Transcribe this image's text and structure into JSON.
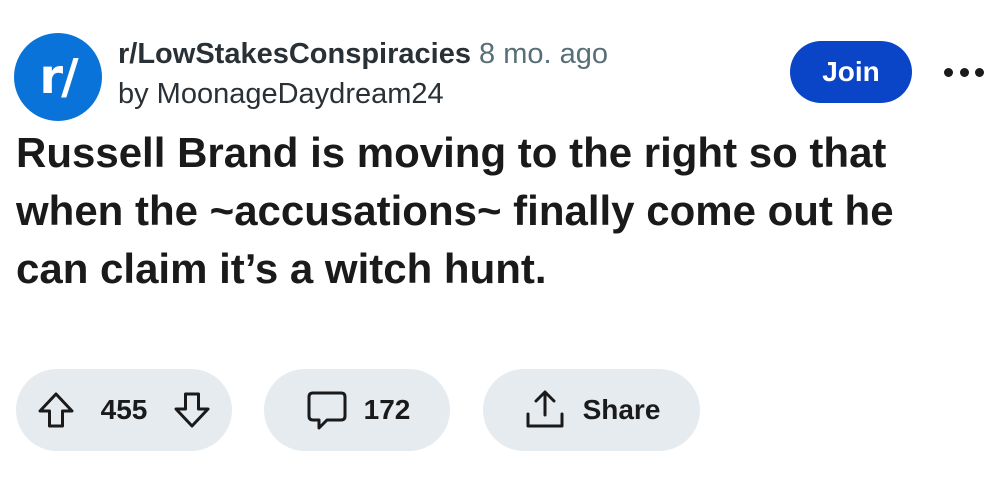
{
  "post": {
    "subreddit_avatar_text": "r/",
    "subreddit": "r/LowStakesConspiracies",
    "time_ago": "8 mo. ago",
    "author_line": "by MoonageDaydream24",
    "join_label": "Join",
    "title": "Russell Brand is moving to the right so that when the ~accusations~ finally come out he can claim it’s a witch hunt."
  },
  "actions": {
    "upvote_count": "455",
    "comment_count": "172",
    "share_label": "Share"
  },
  "colors": {
    "avatar_bg": "#0a73d9",
    "join_bg": "#0a45c7",
    "pill_bg": "#e5ebee"
  },
  "icons": {
    "upvote": "arrow-up-outline-icon",
    "downvote": "arrow-down-outline-icon",
    "comment": "speech-bubble-icon",
    "share": "share-upload-icon",
    "more": "more-horizontal-icon"
  }
}
